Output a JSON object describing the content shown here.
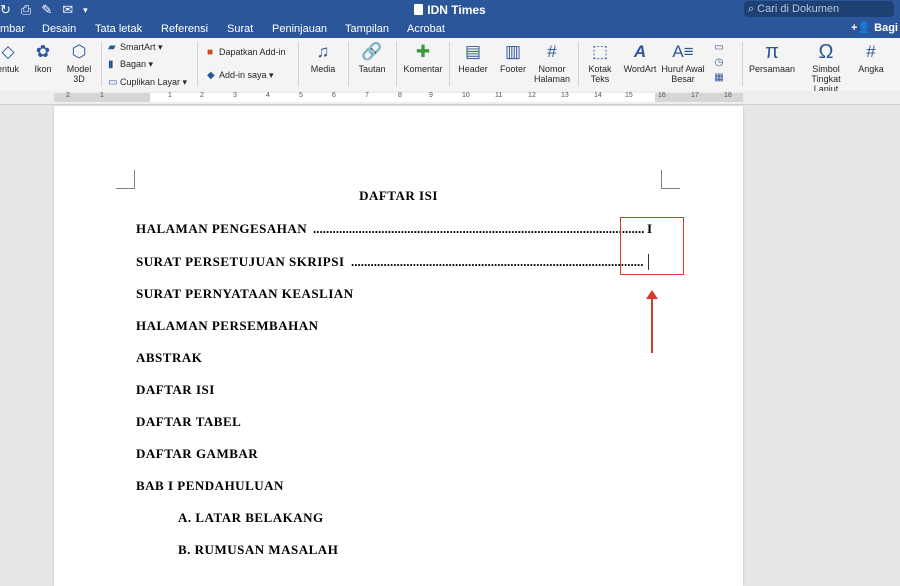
{
  "window": {
    "title": "IDN Times",
    "search_placeholder": "Cari di Dokumen",
    "share_label": "Bagi"
  },
  "tabs": [
    "mbar",
    "Desain",
    "Tata letak",
    "Referensi",
    "Surat",
    "Peninjauan",
    "Tampilan",
    "Acrobat"
  ],
  "ribbon": {
    "bentuk": "entuk",
    "ikon": "Ikon",
    "model3d": "Model 3D",
    "smartart": "SmartArt",
    "bagan": "Bagan",
    "cuplikan": "Cuplikan Layar",
    "dapatkan_addin": "Dapatkan Add-in",
    "addin_saya": "Add-in saya",
    "media": "Media",
    "tautan": "Tautan",
    "komentar": "Komentar",
    "header": "Header",
    "footer": "Footer",
    "nomor_halaman": "Nomor Halaman",
    "kotak_teks": "Kotak Teks",
    "wordart": "WordArt",
    "huruf_awal": "Huruf Awal Besar",
    "persamaan": "Persamaan",
    "simbol": "Simbol Tingkat Lanjut",
    "angka": "Angka"
  },
  "ruler": {
    "numbers": [
      "2",
      "1",
      "1",
      "2",
      "3",
      "4",
      "5",
      "6",
      "7",
      "8",
      "9",
      "10",
      "11",
      "12",
      "13",
      "14",
      "15",
      "16",
      "17",
      "18"
    ]
  },
  "document": {
    "title": "DAFTAR ISI",
    "entries": [
      {
        "label": "HALAMAN PENGESAHAN",
        "page": "I"
      },
      {
        "label": "SURAT PERSETUJUAN SKRIPSI",
        "page": ""
      },
      {
        "label": "SURAT PERNYATAAN KEASLIAN"
      },
      {
        "label": "HALAMAN PERSEMBAHAN"
      },
      {
        "label": "ABSTRAK"
      },
      {
        "label": "DAFTAR ISI"
      },
      {
        "label": "DAFTAR TABEL"
      },
      {
        "label": "DAFTAR GAMBAR"
      },
      {
        "label": "BAB I  PENDAHULUAN"
      },
      {
        "label": "A.  LATAR BELAKANG"
      },
      {
        "label": "B.  RUMUSAN MASALAH"
      }
    ]
  },
  "colors": {
    "word_blue": "#2b579a",
    "highlight_red": "#d63a2d"
  }
}
